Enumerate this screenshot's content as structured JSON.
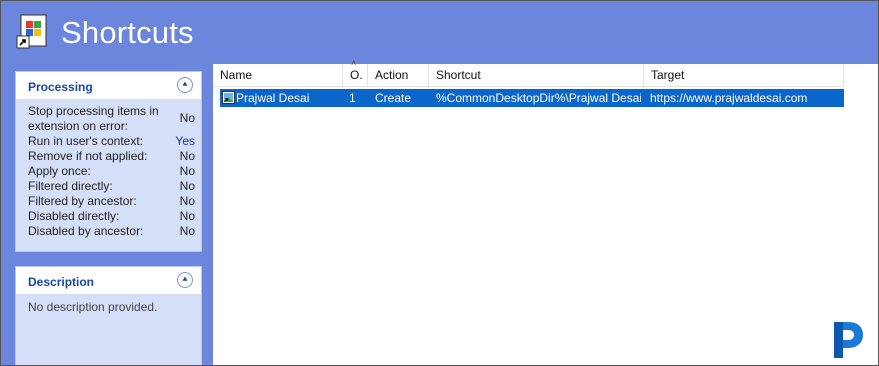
{
  "header": {
    "title": "Shortcuts",
    "icon": "shortcut-app-icon"
  },
  "processing": {
    "title": "Processing",
    "rows": [
      {
        "label": "Stop processing items in extension on error:",
        "value": "No"
      },
      {
        "label": "Run in user's context:",
        "value": "Yes"
      },
      {
        "label": "Remove if not applied:",
        "value": "No"
      },
      {
        "label": "Apply once:",
        "value": "No"
      },
      {
        "label": "Filtered directly:",
        "value": "No"
      },
      {
        "label": "Filtered by ancestor:",
        "value": "No"
      },
      {
        "label": "Disabled directly:",
        "value": "No"
      },
      {
        "label": "Disabled by ancestor:",
        "value": "No"
      }
    ]
  },
  "description": {
    "title": "Description",
    "text": "No description provided."
  },
  "table": {
    "columns": [
      "Name",
      "O.",
      "Action",
      "Shortcut",
      "Target"
    ],
    "rows": [
      {
        "name": "Prajwal Desai",
        "order": "1",
        "action": "Create",
        "shortcut": "%CommonDesktopDir%\\Prajwal Desai",
        "target": "https://www.prajwaldesai.com"
      }
    ]
  },
  "colors": {
    "banner": "#6b86dc",
    "selected_row": "#0b66cc",
    "panel_title": "#1a46a6",
    "yes_value": "#1b35b5"
  }
}
